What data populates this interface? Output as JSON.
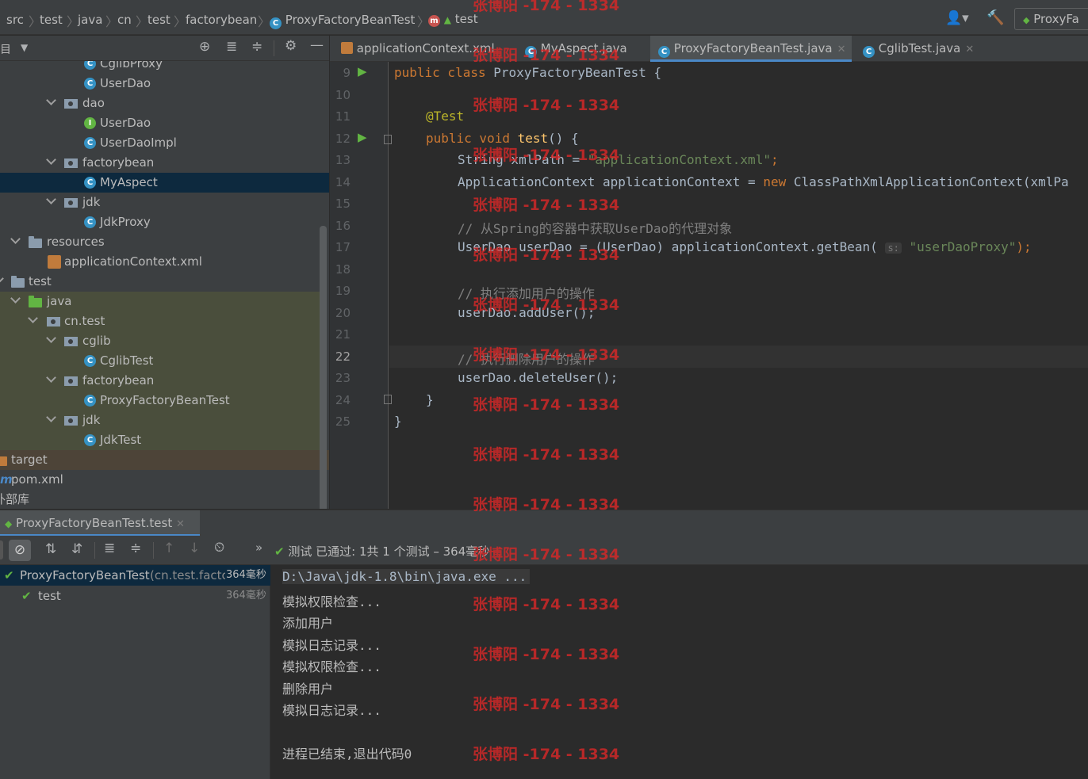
{
  "breadcrumbs": [
    "src",
    "test",
    "java",
    "cn",
    "test",
    "factorybean",
    "ProxyFactoryBeanTest",
    "test"
  ],
  "toolbar": {
    "run_config": "ProxyFa"
  },
  "project_tree": [
    {
      "label": "CglibProxy",
      "icon": "class-icon"
    },
    {
      "label": "UserDao",
      "icon": "class-icon"
    },
    {
      "label": "dao",
      "icon": "package-folder-icon"
    },
    {
      "label": "UserDao",
      "icon": "interface-icon"
    },
    {
      "label": "UserDaoImpl",
      "icon": "class-icon"
    },
    {
      "label": "factorybean",
      "icon": "package-folder-icon"
    },
    {
      "label": "MyAspect",
      "icon": "class-icon"
    },
    {
      "label": "jdk",
      "icon": "package-folder-icon"
    },
    {
      "label": "JdkProxy",
      "icon": "class-icon"
    },
    {
      "label": "resources",
      "icon": "resources-folder-icon"
    },
    {
      "label": "applicationContext.xml",
      "icon": "xml-file-icon"
    },
    {
      "label": "test",
      "icon": "folder-icon"
    },
    {
      "label": "java",
      "icon": "test-source-folder-icon"
    },
    {
      "label": "cn.test",
      "icon": "package-folder-icon"
    },
    {
      "label": "cglib",
      "icon": "package-folder-icon"
    },
    {
      "label": "CglibTest",
      "icon": "test-class-icon"
    },
    {
      "label": "factorybean",
      "icon": "package-folder-icon"
    },
    {
      "label": "ProxyFactoryBeanTest",
      "icon": "test-class-icon"
    },
    {
      "label": "jdk",
      "icon": "package-folder-icon"
    },
    {
      "label": "JdkTest",
      "icon": "test-class-icon"
    },
    {
      "label": "target",
      "icon": "excluded-folder-icon"
    },
    {
      "label": "pom.xml",
      "icon": "maven-icon"
    },
    {
      "label": "外部库",
      "icon": "library-icon"
    }
  ],
  "editor_tabs": [
    {
      "label": "applicationContext.xml",
      "active": false
    },
    {
      "label": "MyAspect.java",
      "active": false
    },
    {
      "label": "ProxyFactoryBeanTest.java",
      "active": true
    },
    {
      "label": "CglibTest.java",
      "active": false
    }
  ],
  "line_numbers": [
    "9",
    "10",
    "11",
    "12",
    "13",
    "14",
    "15",
    "16",
    "17",
    "18",
    "19",
    "20",
    "21",
    "22",
    "23",
    "24",
    "25"
  ],
  "code": {
    "l9_kw": "public class ",
    "l9_name": "ProxyFactoryBeanTest {",
    "l11_ann": "@Test",
    "l12_kw": "public void ",
    "l12_fn": "test",
    "l12_rest": "() {",
    "l13_a": "String xmlPath = ",
    "l13_str": "\"applicationContext.xml\"",
    "l13_end": ";",
    "l14_a": "ApplicationContext applicationContext = ",
    "l14_kw": "new ",
    "l14_b": "ClassPathXmlApplicationContext(xmlPa",
    "l16": "// 从Spring的容器中获取UserDao的代理对象",
    "l17_a": "UserDao userDao = (UserDao) applicationContext.getBean( ",
    "l17_hint": "s:",
    "l17_str": "\"userDaoProxy\"",
    "l17_end": ");",
    "l19": "// 执行添加用户的操作",
    "l20": "userDao.addUser();",
    "l22": "// 执行删除用户的操作",
    "l23": "userDao.deleteUser();",
    "l24": "}",
    "l25": "}"
  },
  "run_tab": {
    "label": "ProxyFactoryBeanTest.test"
  },
  "test_status": "测试 已通过: 1共 1 个测试 – 364毫秒",
  "test_results": [
    {
      "name": "ProxyFactoryBeanTest",
      "pkg": "(cn.test.factc",
      "time": "364毫秒"
    },
    {
      "name": "test",
      "time": "364毫秒"
    }
  ],
  "console_lines": [
    "D:\\Java\\jdk-1.8\\bin\\java.exe ...",
    "模拟权限检查...",
    "添加用户",
    "模拟日志记录...",
    "模拟权限检查...",
    "删除用户",
    "模拟日志记录...",
    "",
    "进程已结束,退出代码0"
  ],
  "watermark": "张博阳 -174 - 1334"
}
